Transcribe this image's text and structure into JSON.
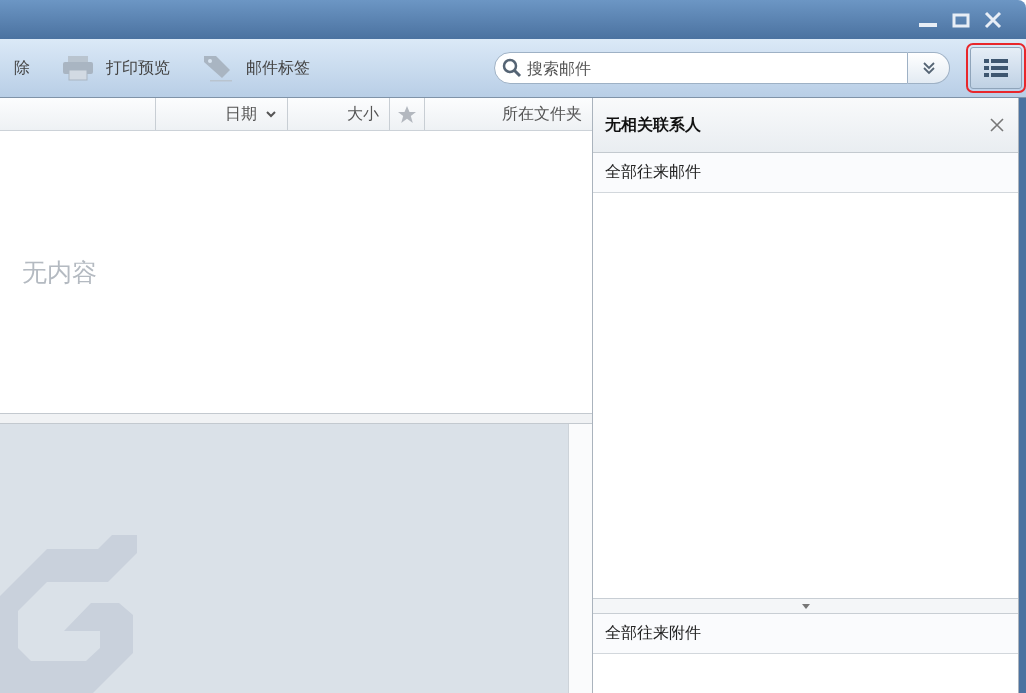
{
  "toolbar": {
    "buttons": [
      {
        "kind": "text",
        "label": "除"
      },
      {
        "kind": "printer",
        "label": "打印预览"
      },
      {
        "kind": "tag",
        "label": "邮件标签"
      }
    ],
    "search": {
      "placeholder": "搜索邮件"
    },
    "view_button": {
      "highlighted": true
    }
  },
  "mail_list": {
    "columns": [
      {
        "kind": "blank"
      },
      {
        "kind": "sort",
        "label": "日期"
      },
      {
        "kind": "text",
        "label": "大小"
      },
      {
        "kind": "star"
      },
      {
        "kind": "text",
        "label": "所在文件夹"
      }
    ],
    "empty_text": "无内容"
  },
  "contact_panel": {
    "title": "无相关联系人",
    "mails_header": "全部往来邮件",
    "attachments_header": "全部往来附件"
  }
}
